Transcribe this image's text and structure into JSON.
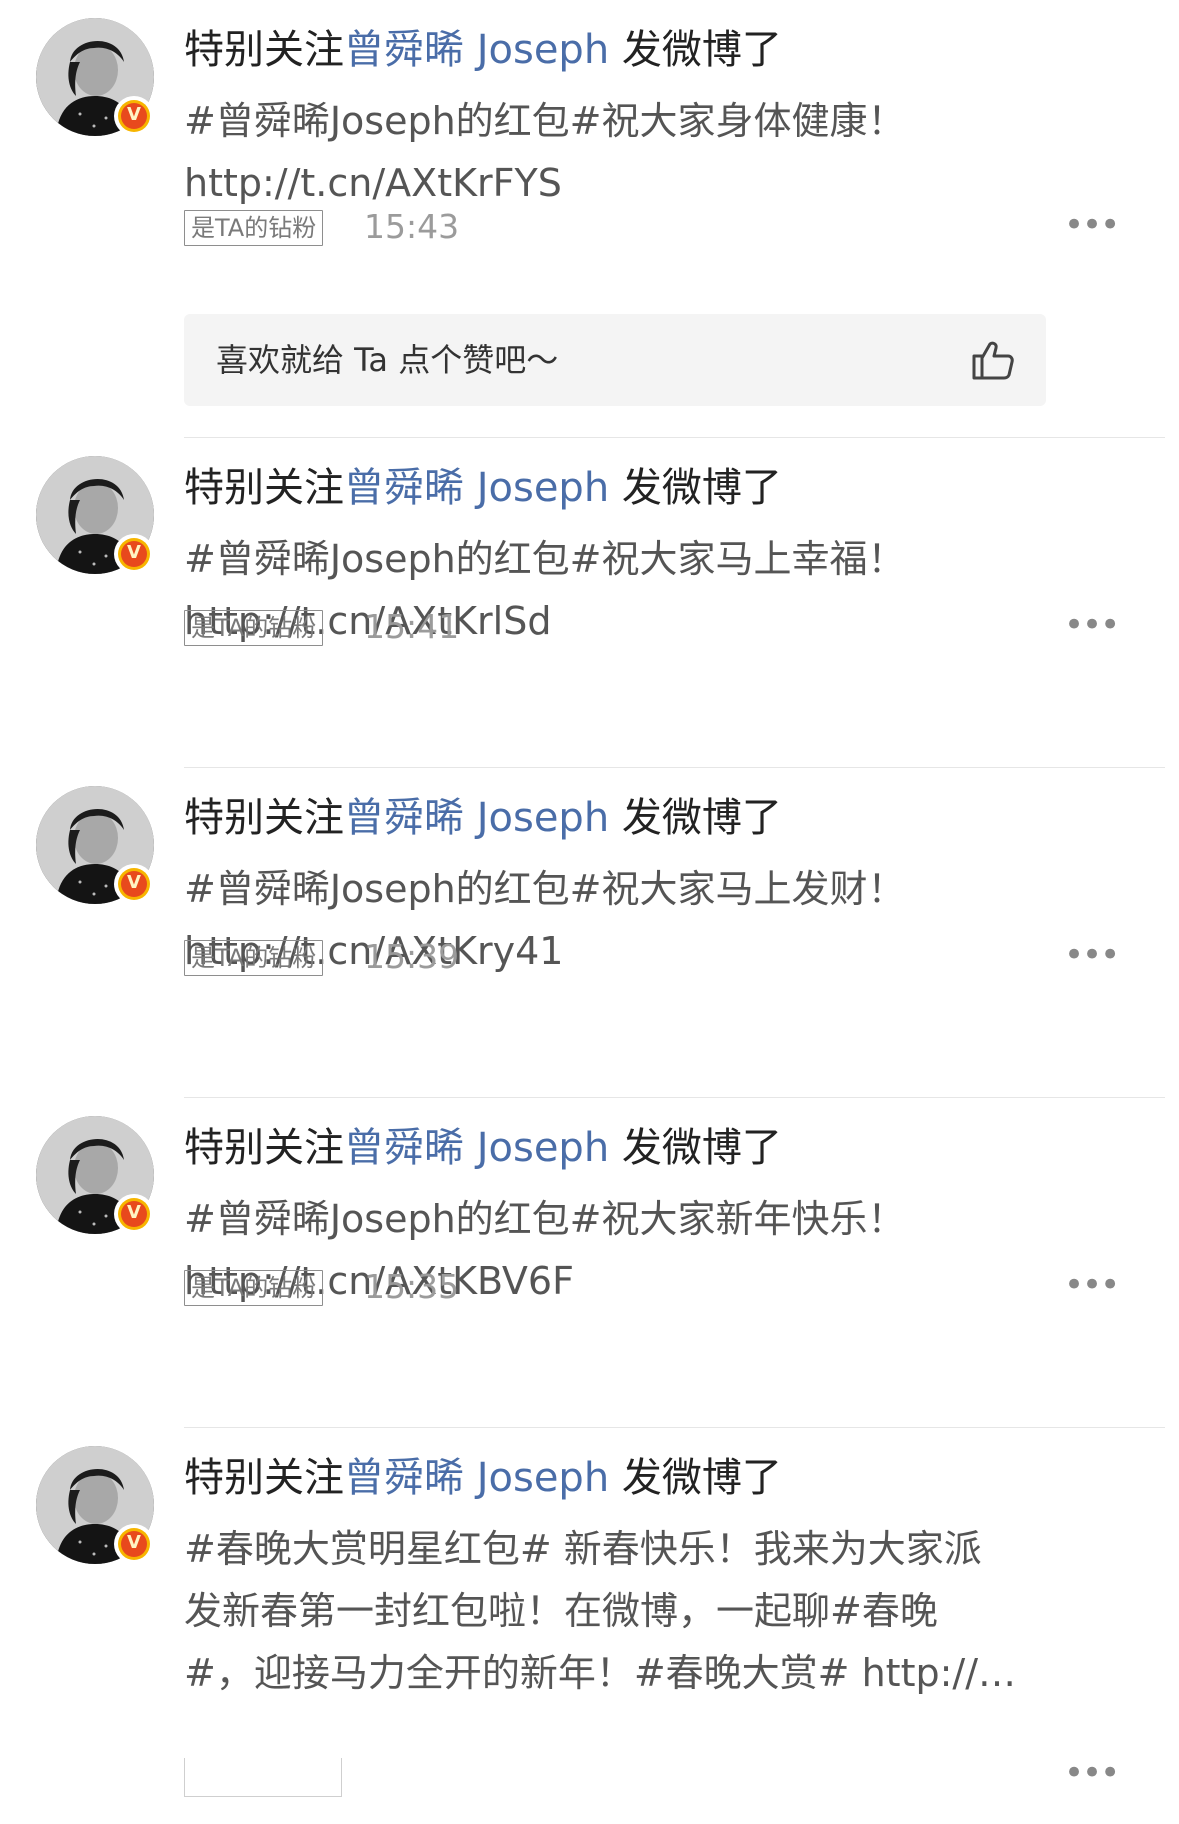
{
  "posts": [
    {
      "prefix": "特别关注",
      "user": "曾舜晞 Joseph",
      "suffix": "发微博了",
      "lines": [
        "#曾舜晞Joseph的红包#祝大家身体健康！",
        "http://t.cn/AXtKrFYS"
      ],
      "fan_badge": "是TA的钻粉",
      "time": "15:43",
      "more": "•••",
      "like_prompt": "喜欢就给 Ta 点个赞吧～"
    },
    {
      "prefix": "特别关注",
      "user": "曾舜晞 Joseph",
      "suffix": "发微博了",
      "lines": [
        "#曾舜晞Joseph的红包#祝大家马上幸福！",
        "http://t.cn/AXtKrlSd"
      ],
      "fan_badge": "是TA的钻粉",
      "time": "15:41",
      "more": "•••"
    },
    {
      "prefix": "特别关注",
      "user": "曾舜晞 Joseph",
      "suffix": "发微博了",
      "lines": [
        "#曾舜晞Joseph的红包#祝大家马上发财！",
        "http://t.cn/AXtKry41"
      ],
      "fan_badge": "是TA的钻粉",
      "time": "15:39",
      "more": "•••"
    },
    {
      "prefix": "特别关注",
      "user": "曾舜晞 Joseph",
      "suffix": "发微博了",
      "lines": [
        "#曾舜晞Joseph的红包#祝大家新年快乐！",
        "http://t.cn/AXtKBV6F"
      ],
      "fan_badge": "是TA的钻粉",
      "time": "15:35",
      "more": "•••"
    },
    {
      "prefix": "特别关注",
      "user": "曾舜晞 Joseph",
      "suffix": "发微博了",
      "lines": [
        "#春晚大赏明星红包# 新春快乐！我来为大家派",
        "发新春第一封红包啦！在微博，一起聊#春晚",
        "#，迎接马力全开的新年！#春晚大赏# http://…"
      ],
      "more": "•••"
    }
  ],
  "verified_badge_glyph": "V",
  "colors": {
    "username": "#4a6da8",
    "badge_orange": "#e8491d",
    "badge_yellow": "#f7b500",
    "like_bar_bg": "#f4f4f4"
  },
  "icons": {
    "more": "more-dots-icon",
    "like": "thumbs-up-icon",
    "verified": "verified-v-icon"
  }
}
